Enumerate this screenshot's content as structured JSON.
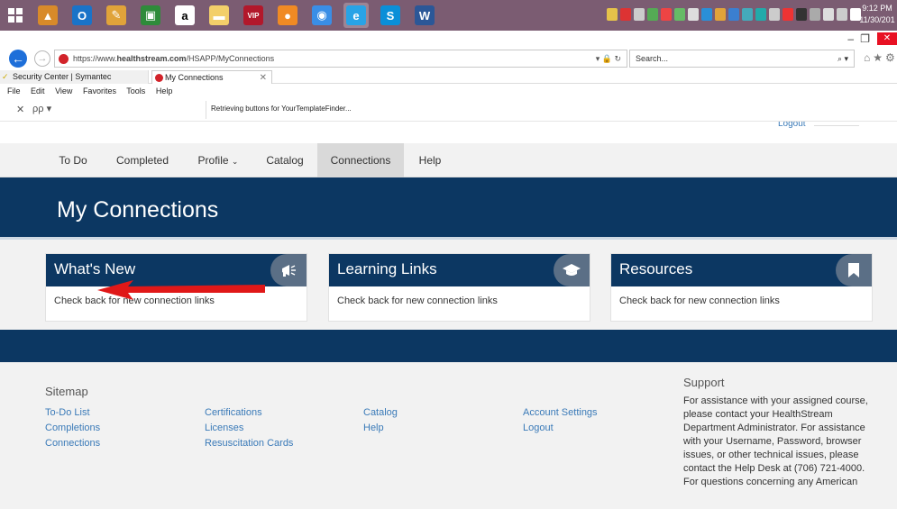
{
  "taskbar": {
    "clock_time": "9:12 PM",
    "clock_date": "11/30/201",
    "apps": [
      {
        "icon": "manager-icon",
        "color": "#d88a2a",
        "glyph": "▲"
      },
      {
        "icon": "outlook-icon",
        "color": "#1a73c8",
        "glyph": "O"
      },
      {
        "icon": "paint-icon",
        "color": "#e0a33a",
        "glyph": "✎"
      },
      {
        "icon": "calendar-icon",
        "color": "#2e8b3a",
        "glyph": "▣"
      },
      {
        "icon": "amazon-icon",
        "color": "#ffffff",
        "glyph": "a"
      },
      {
        "icon": "folder-icon",
        "color": "#f3cf6a",
        "glyph": "▬"
      },
      {
        "icon": "vip-icon",
        "color": "#b2182b",
        "glyph": "VIP"
      },
      {
        "icon": "firefox-icon",
        "color": "#f08a24",
        "glyph": "●"
      },
      {
        "icon": "chrome-icon",
        "color": "#3a8ee6",
        "glyph": "◉"
      },
      {
        "icon": "ie-icon",
        "color": "#28a3e6",
        "glyph": "e"
      },
      {
        "icon": "skype-icon",
        "color": "#0a8fd8",
        "glyph": "S"
      },
      {
        "icon": "word-icon",
        "color": "#2b5797",
        "glyph": "W"
      }
    ]
  },
  "browser": {
    "url_prefix": "https://www.",
    "url_domain": "healthstream.com",
    "url_path": "/HSAPP/MyConnections",
    "search_placeholder": "Search...",
    "tabs": [
      {
        "label": "Security Center | Symantec"
      },
      {
        "label": "My Connections"
      }
    ],
    "menu": [
      "File",
      "Edit",
      "View",
      "Favorites",
      "Tools",
      "Help"
    ],
    "status_text": "Retrieving buttons for YourTemplateFinder..."
  },
  "page": {
    "logout_top": "Logout",
    "nav": [
      "To Do",
      "Completed",
      "Profile",
      "Catalog",
      "Connections",
      "Help"
    ],
    "hero_title": "My Connections",
    "cards": [
      {
        "title": "What's New",
        "body": "Check back for new connection links",
        "icon": "megaphone-icon"
      },
      {
        "title": "Learning Links",
        "body": "Check back for new connection links",
        "icon": "graduation-cap-icon"
      },
      {
        "title": "Resources",
        "body": "Check back for new connection links",
        "icon": "bookmark-icon"
      }
    ],
    "footer": {
      "sitemap_title": "Sitemap",
      "links": {
        "todo": "To-Do List",
        "completions": "Completions",
        "connections": "Connections",
        "certifications": "Certifications",
        "licenses": "Licenses",
        "resuscitation": "Resuscitation Cards",
        "catalog": "Catalog",
        "help": "Help",
        "account": "Account Settings",
        "logout": "Logout"
      },
      "support_title": "Support",
      "support_text": "For assistance with your assigned course, please contact your HealthStream Department Administrator. For assistance with your Username, Password, browser issues, or other technical issues, please contact the Help Desk at (706) 721-4000. For questions concerning any American"
    }
  }
}
